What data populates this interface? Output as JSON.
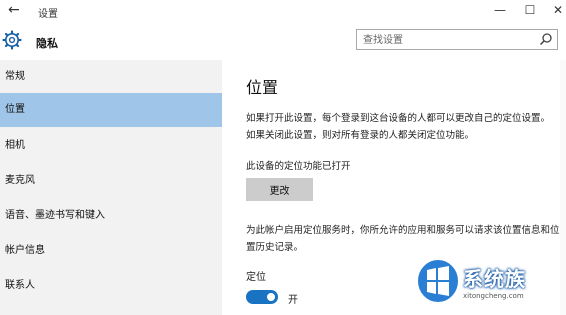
{
  "window": {
    "title": "设置",
    "back_symbol": "←",
    "minimize_symbol": "—",
    "maximize_symbol": "☐",
    "close_symbol": "✕"
  },
  "header": {
    "section_title": "隐私",
    "icon": "gear-icon"
  },
  "search": {
    "placeholder": "查找设置",
    "icon": "search-icon"
  },
  "sidebar": {
    "items": [
      {
        "label": "常规",
        "active": false
      },
      {
        "label": "位置",
        "active": true
      },
      {
        "label": "相机",
        "active": false
      },
      {
        "label": "麦克风",
        "active": false
      },
      {
        "label": "语音、墨迹书写和键入",
        "active": false
      },
      {
        "label": "帐户信息",
        "active": false
      },
      {
        "label": "联系人",
        "active": false
      }
    ]
  },
  "main": {
    "title": "位置",
    "description": "如果打开此设置，每个登录到这台设备的人都可以更改自己的定位设置。如果关闭此设置，则对所有登录的人都关闭定位功能。",
    "device_status": "此设备的定位功能已打开",
    "change_button": "更改",
    "account_description": "为此帐户启用定位服务时，你所允许的应用和服务可以请求该位置信息和位置历史记录。",
    "location_label": "定位",
    "toggle_state": "开",
    "toggle_on": true
  },
  "watermark": {
    "brand": "系统族",
    "url": "xitongcheng.com"
  },
  "colors": {
    "active_item": "#9fc6e8",
    "sidebar_bg": "#f2f2f2",
    "toggle_on": "#1a73c2",
    "button_bg": "#cccccc"
  }
}
